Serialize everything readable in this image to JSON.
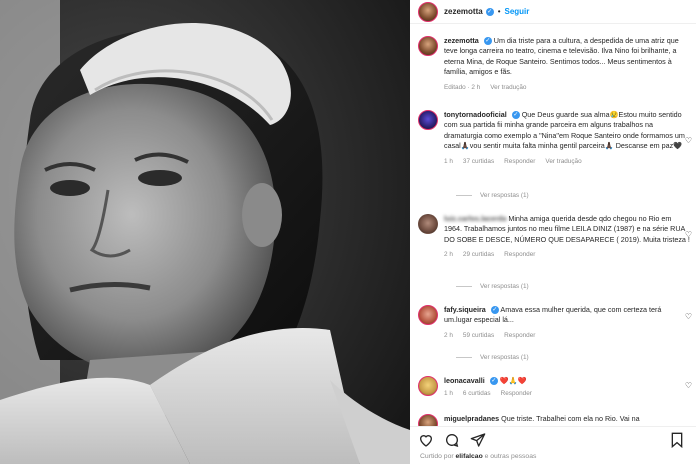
{
  "post": {
    "username": "zezemotta",
    "follow_label": "Seguir",
    "caption": "Um dia triste para a cultura, a despedida de uma atriz que teve longa carreira no teatro, cinema e televisão. Ilva Nino foi brilhante, a eterna Mina, de Roque Santeiro. Sentimos todos... Meus sentimentos à família, amigos e fãs.",
    "edited": "Editado · 2 h",
    "see_translation": "Ver tradução",
    "liked_by_prefix": "Curtido por",
    "liked_by_user": "elifalcao",
    "liked_by_suffix": "e outras pessoas"
  },
  "comments": [
    {
      "username": "tonytornadooficial",
      "text": "Que Deus guarde sua alma😢Estou muito sentido com sua partida fii minha grande parceira em alguns trabalhos na dramaturgia como exemplo a \"Nina\"em Roque Santeiro onde formamos um casal🙏🏿vou sentir muita falta minha gentil parceira🙏🏿 Descanse em paz🖤",
      "time": "1 h",
      "likes": "37 curtidas",
      "reply": "Responder",
      "translate": "Ver tradução",
      "replies": "Ver respostas (1)"
    },
    {
      "username": "luiz.carlos.lacerda",
      "text": "Minha amiga querida desde qdo chegou no Rio em 1964. Trabalhamos juntos no meu filme LEILA DINIZ (1987) e na série RUA DO SOBE E DESCE, NÚMERO QUE DESAPARECE ( 2019). Muita tristeza !",
      "time": "2 h",
      "likes": "29 curtidas",
      "reply": "Responder",
      "translate": "",
      "replies": "Ver respostas (1)"
    },
    {
      "username": "fafy.siqueira",
      "text": "Amava essa mulher querida, que com certeza terá um.lugar especial lá...",
      "time": "2 h",
      "likes": "59 curtidas",
      "reply": "Responder",
      "translate": "",
      "replies": "Ver respostas (1)"
    },
    {
      "username": "leonacavalli",
      "text": "❤️🙏❤️",
      "time": "1 h",
      "likes": "6 curtidas",
      "reply": "Responder",
      "translate": "",
      "replies": ""
    },
    {
      "username": "miguelpradanes",
      "text": "Que triste. Trabalhei com ela no Rio. Vai na",
      "time": "",
      "likes": "",
      "reply": "",
      "translate": "",
      "replies": ""
    }
  ],
  "icons": [
    "heart-icon",
    "comment-icon",
    "share-icon",
    "bookmark-icon",
    "verified-icon"
  ],
  "colors": {
    "accent": "#0095f6",
    "verified": "#3897f0",
    "muted": "#8e8e8e",
    "text": "#262626"
  }
}
